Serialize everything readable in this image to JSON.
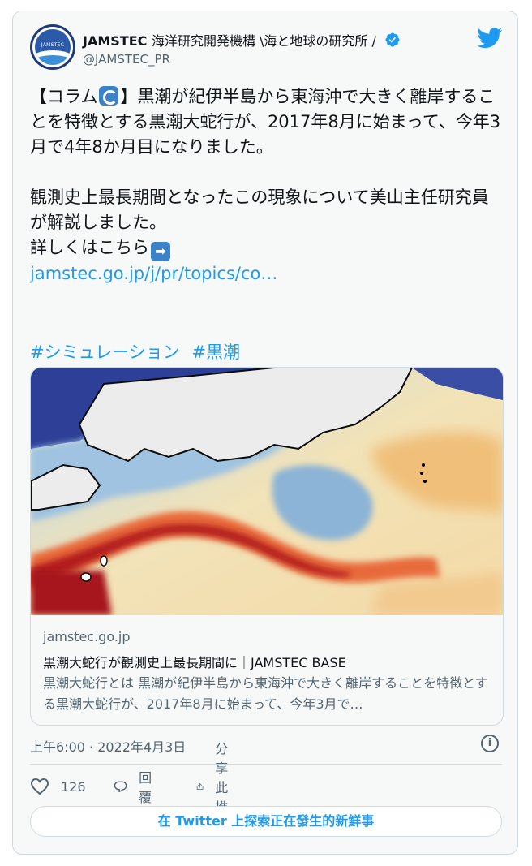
{
  "author": {
    "display_name": "JAMSTEC",
    "display_name_rest": "海洋研究開発機構 \\海と地球の研究所 /",
    "handle": "@JAMSTEC_PR",
    "avatar_text": "JAMSTEC"
  },
  "tweet": {
    "line1_pre": "【コラム",
    "line1_post": "】黒潮が紀伊半島から東海沖で大きく離岸することを特徴とする黒潮大蛇行が、2017年8月に始まって、今年3月で4年8か月目になりました。",
    "para2": "観測史上最長期間となったこの現象について美山主任研究員が解説しました。",
    "para3": "詳しくはこちら",
    "link": "jamstec.go.jp/j/pr/topics/co…",
    "hashtags": [
      "#シミュレーション",
      "#黒潮"
    ]
  },
  "link_card": {
    "domain": "jamstec.go.jp",
    "title": "黒潮大蛇行が観測史上最長期間に｜JAMSTEC BASE",
    "description": "黒潮大蛇行とは 黒潮が紀伊半島から東海沖で大きく離岸することを特徴とする黒潮大蛇行が、2017年8月に始まって、今年3月で…"
  },
  "timestamp": "上午6:00 · 2022年4月3日",
  "actions": {
    "like_count": "126",
    "reply_label": "回覆",
    "share_label": "分享此推文"
  },
  "explore_label": "在 Twitter 上探索正在發生的新鮮事",
  "colors": {
    "accent": "#1d9bf0",
    "verified": "#1d9bf0",
    "text": "#0f1419",
    "muted": "#536471"
  }
}
